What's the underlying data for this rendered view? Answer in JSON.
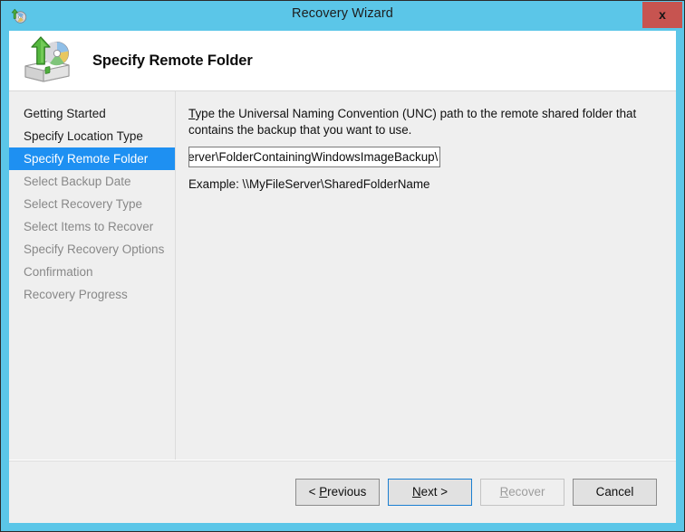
{
  "window": {
    "title": "Recovery Wizard",
    "icon": "recovery-wizard-icon",
    "close_label": "x",
    "chrome_color": "#5bc6e8",
    "close_color": "#c75450"
  },
  "header": {
    "title": "Specify Remote Folder",
    "icon": "backup-drive-restore-icon"
  },
  "sidebar": {
    "items": [
      {
        "label": "Getting Started",
        "state": "done"
      },
      {
        "label": "Specify Location Type",
        "state": "done"
      },
      {
        "label": "Specify Remote Folder",
        "state": "current"
      },
      {
        "label": "Select Backup Date",
        "state": "upcoming"
      },
      {
        "label": "Select Recovery Type",
        "state": "upcoming"
      },
      {
        "label": "Select Items to Recover",
        "state": "upcoming"
      },
      {
        "label": "Specify Recovery Options",
        "state": "upcoming"
      },
      {
        "label": "Confirmation",
        "state": "upcoming"
      },
      {
        "label": "Recovery Progress",
        "state": "upcoming"
      }
    ],
    "selected_color": "#1e90f2"
  },
  "content": {
    "instruction_accel": "T",
    "instruction_rest": "ype the Universal Naming Convention (UNC) path to the remote shared folder that contains the backup that you want to use.",
    "path_value": "\\\\MyServer\\FolderContainingWindowsImageBackup\\",
    "path_placeholder": "",
    "example": "Example: \\\\MyFileServer\\SharedFolderName"
  },
  "footer": {
    "buttons": [
      {
        "label": "< Previous",
        "accel": "P",
        "state": "enabled"
      },
      {
        "label": "Next >",
        "accel": "N",
        "state": "focused"
      },
      {
        "label": "Recover",
        "accel": "R",
        "state": "disabled"
      },
      {
        "label": "Cancel",
        "accel": "",
        "state": "enabled"
      }
    ]
  }
}
